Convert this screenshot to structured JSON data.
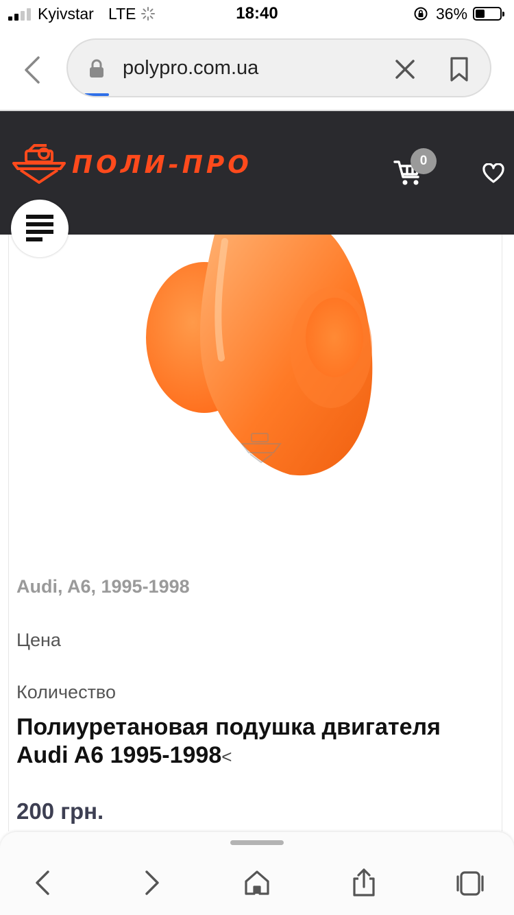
{
  "status_bar": {
    "carrier": "Kyivstar",
    "network": "LTE",
    "time": "18:40",
    "battery_percent": "36%"
  },
  "browser": {
    "url": "polypro.com.ua"
  },
  "site": {
    "logo_text": "ПОЛИ-ПРО",
    "cart_count": "0",
    "brand_color": "#ff4a1c"
  },
  "product": {
    "meta": "Audi, A6, 1995-1998",
    "price_label": "Цена",
    "quantity_label": "Количество",
    "title": "Полиуретановая подушка двигателя Audi A6 1995-1998",
    "title_suffix": "<",
    "price": "200 грн."
  },
  "icons": {
    "back": "chevron-left-icon",
    "lock": "lock-icon",
    "clear": "close-icon",
    "bookmark": "bookmark-icon",
    "cart": "cart-icon",
    "favorite": "heart-icon",
    "menu": "menu-icon",
    "nav_back": "chevron-left-icon",
    "nav_forward": "chevron-right-icon",
    "home": "home-icon",
    "share": "share-icon",
    "tabs": "tabs-icon"
  }
}
